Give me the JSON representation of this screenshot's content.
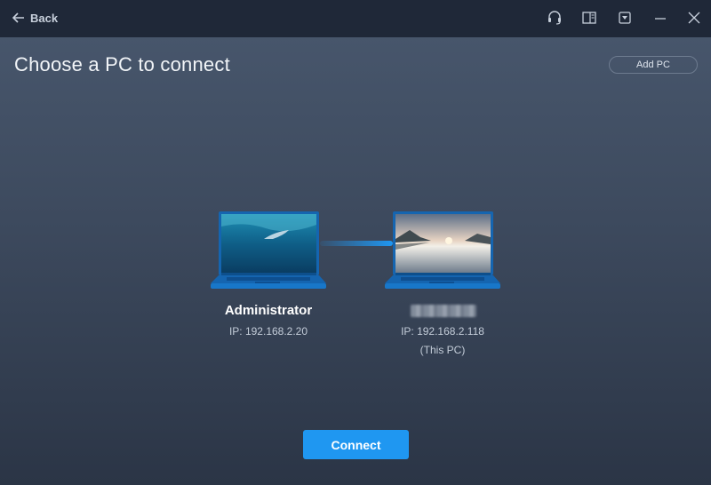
{
  "header": {
    "back_label": "Back",
    "icons": [
      "support-icon",
      "sidebar-icon",
      "dropdown-icon",
      "minimize-icon",
      "close-icon"
    ]
  },
  "main": {
    "title": "Choose a PC to connect",
    "add_pc_label": "Add PC",
    "connect_label": "Connect"
  },
  "pcs": [
    {
      "name": "Administrator",
      "ip": "IP: 192.168.2.20",
      "note": ""
    },
    {
      "name": "",
      "ip": "IP: 192.168.2.118",
      "note": "(This PC)"
    }
  ],
  "colors": {
    "accent": "#1f97f1",
    "titlebar": "#1f2838",
    "laptop": "#1565b0"
  }
}
